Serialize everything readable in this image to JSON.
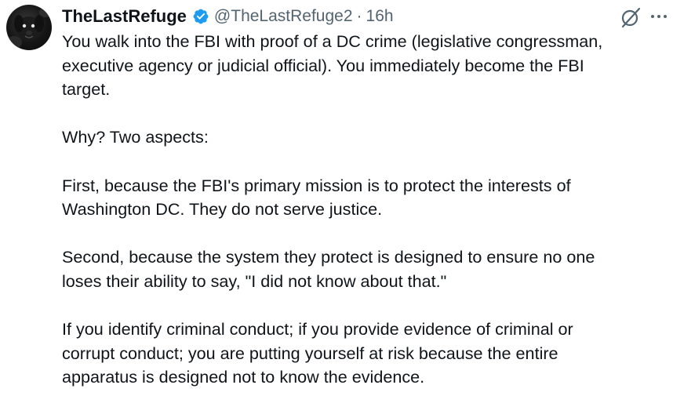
{
  "tweet": {
    "author": {
      "display_name": "TheLastRefuge",
      "handle": "@TheLastRefuge2",
      "separator": "·",
      "timestamp": "16h",
      "verified_badge_color": "#1d9bf0"
    },
    "icons": {
      "grok": "grok-icon",
      "more": "more-options-icon"
    },
    "body": {
      "p1": [
        "You walk into the FBI with proof of a DC crime (legislative congressman,",
        "executive agency or judicial official). You immediately become the FBI",
        "target."
      ],
      "p2": [
        "Why?  Two aspects:"
      ],
      "p3": [
        "First, because the FBI's primary mission is to protect the interests of",
        "Washington DC.  They do not serve justice."
      ],
      "p4": [
        "Second, because the system they protect is designed to ensure no one",
        "loses their ability to say, \"I did not know about that.\""
      ],
      "p5": [
        "If you identify criminal conduct; if you provide evidence of criminal or",
        "corrupt conduct; you are putting yourself at risk because the entire",
        "apparatus is designed not to know the evidence."
      ]
    }
  }
}
